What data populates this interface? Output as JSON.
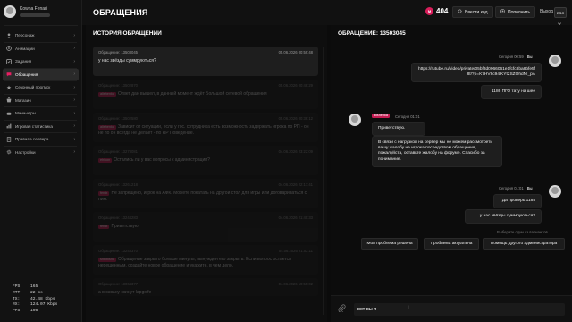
{
  "profile": {
    "name": "Kowna Fenari"
  },
  "nav": [
    {
      "label": "Персонаж",
      "icon": "person-icon"
    },
    {
      "label": "Анимации",
      "icon": "animation-icon"
    },
    {
      "label": "Задания",
      "icon": "tasks-icon"
    },
    {
      "label": "Обращения",
      "icon": "chat-icon",
      "active": true
    },
    {
      "label": "Сезонный пропуск",
      "icon": "pass-icon"
    },
    {
      "label": "Магазин",
      "icon": "shop-icon"
    },
    {
      "label": "Мини-игры",
      "icon": "games-icon"
    },
    {
      "label": "Игровая статистика",
      "icon": "stats-icon"
    },
    {
      "label": "Правила сервера",
      "icon": "rules-icon"
    },
    {
      "label": "Настройки",
      "icon": "settings-icon"
    }
  ],
  "stats": [
    {
      "k": "FPS:",
      "v": "165"
    },
    {
      "k": "RTT:",
      "v": "22 ms"
    },
    {
      "k": "TX:",
      "v": "42.48 Kbps"
    },
    {
      "k": "RX:",
      "v": "124.07 Kbps"
    },
    {
      "k": "PPS:",
      "v": "108"
    }
  ],
  "header": {
    "title": "ОБРАЩЕНИЯ",
    "coins": "404",
    "coin_symbol": "M",
    "promo_label": "Ввести код",
    "topup_label": "Пополнить",
    "logout_label": "Выход",
    "esc_label": "ESC",
    "close_glyph": "✕"
  },
  "history": {
    "title": "ИСТОРИЯ ОБРАЩЕНИЙ",
    "tickets": [
      {
        "id": "Обращение: 13503045",
        "date": "05.06.2026 00:59:48",
        "text": "у нас звёзды суммруються?",
        "tag": ""
      },
      {
        "id": "Обращение: 13502870",
        "date": "05.06.2026 00:48:29",
        "text": "Ответ дан вышел, в данный момент ждёт Большой сетевой обращения",
        "tag": "alishenka"
      },
      {
        "id": "Обращение: 13502580",
        "date": "05.06.2026 00:38:12",
        "text": "Зависит от ситуации, если у гос. сотрудника есть возможность задержать игрока по РП - он не по он всегда не делает - по RP Поведение.",
        "tag": "alishenka"
      },
      {
        "id": "Обращение: 13278081",
        "date": "04.06.2026 23:22:09",
        "text": "Остались ли у вас вопросы к администрации?",
        "tag": "ehikon"
      },
      {
        "id": "Обращение: 13261218",
        "date": "04.06.2026 22:17:41",
        "text": "Не запрещено, игрок на АФК. Можете покатать на другой стол для игры или договариваться с ним.",
        "tag": "ferrix"
      },
      {
        "id": "Обращение: 13244283",
        "date": "04.06.2026 21:40:33",
        "text": "Приветствую.",
        "tag": "ferrix"
      },
      {
        "id": "Обращение: 13243370",
        "date": "04.06.2026 21:02:11",
        "text": "Обращение закрыто больше минуты, вынужден его закрыть. Если вопрос остается нерешенным, создайте новое обращение и укажите, в чем дело.",
        "tag": "shelbisha"
      },
      {
        "id": "Обращение: 13064377",
        "date": "04.06.2026 19:55:02",
        "text": "а в сэвану скинут lapgolfe",
        "tag": ""
      }
    ]
  },
  "chat": {
    "title": "ОБРАЩЕНИЕ: 13503045",
    "you_label": "Вы",
    "today1": "Сегодня 00:59",
    "link_text": "https://rutube.ru/video/private/05bf3d0966061e1fcfc8ba8bfe5f8f/?p=K7HV8c94iKYt2SZOhdNI_pA",
    "msg_1186": "1186 ПГО тату на шее",
    "admin_name": "alishenka",
    "today_admin": "Сегодня 01:01",
    "admin_greet": "Приветствую.",
    "admin_text": "В связи с нагрузкой на сервер мы не можем рассмотреть вашу жалобу на игрока посредством обращения, пожалуйста, оставьте жалобу на форуме. Спасибо за понимание.",
    "today2": "Сегодня 01:01",
    "msg_check": "Да проверь 1185",
    "msg_stars": "у нас звёзды суммруються?",
    "hint": "Выберите один из вариантов",
    "quick": [
      "Моя проблема решена",
      "Проблема актуальна",
      "Помощь другого администратора"
    ],
    "input_value": "вот вы п",
    "caret_glyph": "I",
    "clip_glyph": "⌀"
  }
}
